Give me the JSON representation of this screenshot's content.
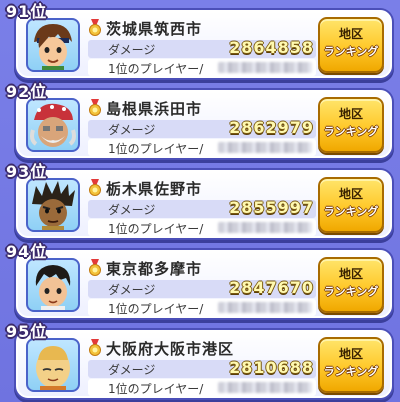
{
  "labels": {
    "damage": "ダメージ",
    "player": "1位のプレイヤー/",
    "button_line1": "地区",
    "button_line2": "ランキング"
  },
  "entries": [
    {
      "rank": "91位",
      "city": "茨城県筑西市",
      "damage": "2864858",
      "avatar": "boy-headband"
    },
    {
      "rank": "92位",
      "city": "島根県浜田市",
      "damage": "2862979",
      "avatar": "old-man-bandana"
    },
    {
      "rank": "93位",
      "city": "栃木県佐野市",
      "damage": "2855997",
      "avatar": "spiky-dark-hair"
    },
    {
      "rank": "94位",
      "city": "東京都多摩市",
      "damage": "2847670",
      "avatar": "boy-short-hair"
    },
    {
      "rank": "95位",
      "city": "大阪府大阪市港区",
      "damage": "2810688",
      "avatar": "bald-monk"
    }
  ],
  "colors": {
    "accent": "#ffc82a",
    "background": "#7a7fe8",
    "damage_text": "#fff9b0"
  }
}
